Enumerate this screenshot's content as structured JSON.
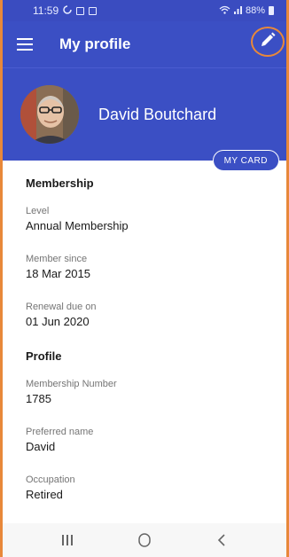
{
  "status_bar": {
    "time": "11:59",
    "battery_text": "88%",
    "icons": [
      "sync-icon",
      "mail-icon",
      "image-icon",
      "wifi-icon",
      "signal-icon",
      "battery-icon"
    ]
  },
  "app_bar": {
    "title": "My profile",
    "menu_icon": "menu-icon",
    "edit_icon": "pencil-icon"
  },
  "header": {
    "name": "David Boutchard",
    "my_card_label": "MY CARD"
  },
  "membership": {
    "title": "Membership",
    "fields": [
      {
        "label": "Level",
        "value": "Annual Membership"
      },
      {
        "label": "Member since",
        "value": "18 Mar 2015"
      },
      {
        "label": "Renewal due on",
        "value": "01 Jun 2020"
      }
    ]
  },
  "profile": {
    "title": "Profile",
    "fields": [
      {
        "label": "Membership Number",
        "value": "1785"
      },
      {
        "label": "Preferred name",
        "value": "David"
      },
      {
        "label": "Occupation",
        "value": "Retired"
      }
    ]
  },
  "nav_bar": {
    "items": [
      "recents-icon",
      "home-icon",
      "back-icon"
    ]
  },
  "colors": {
    "primary": "#3b4fc4",
    "highlight": "#e8883a"
  }
}
